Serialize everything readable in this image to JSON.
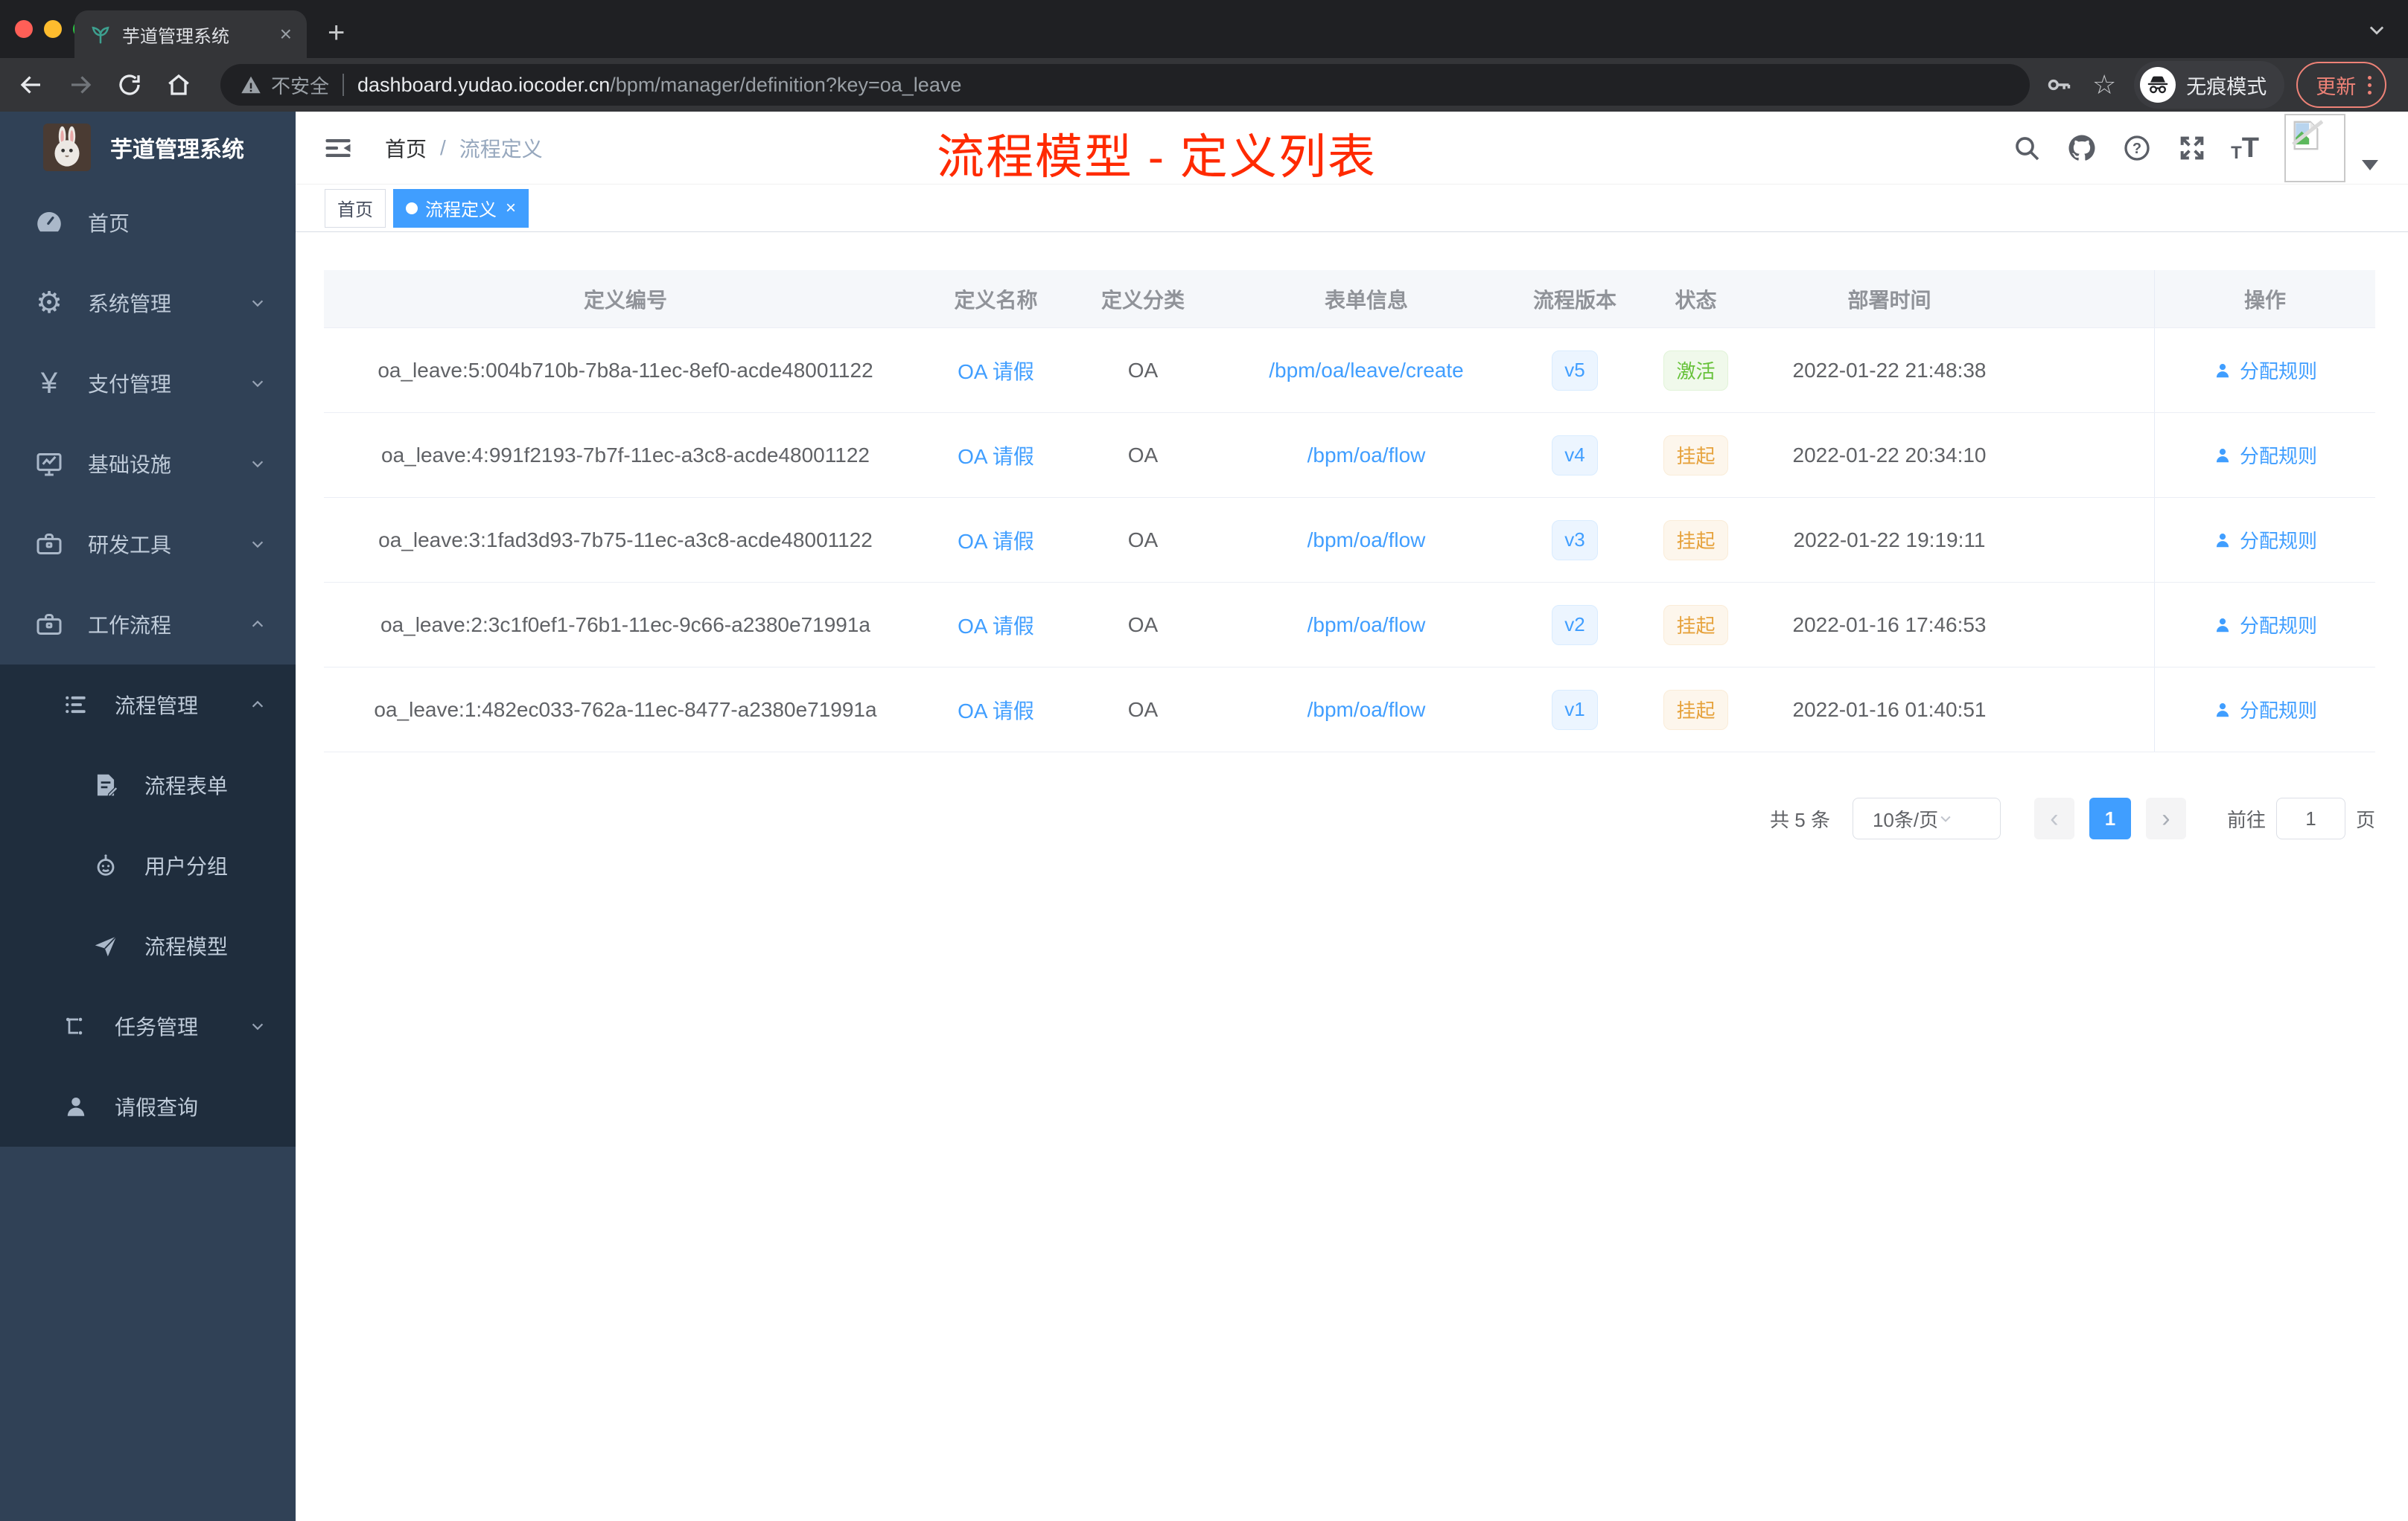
{
  "browser": {
    "tab_title": "芋道管理系统",
    "not_secure_label": "不安全",
    "url_host": "dashboard.yudao.iocoder.cn",
    "url_path": "/bpm/manager/definition?key=oa_leave",
    "incognito_label": "无痕模式",
    "update_label": "更新"
  },
  "icons": {
    "close_glyph": "×",
    "new_tab_glyph": "+",
    "star_glyph": "☆",
    "gear_glyph": "⚙",
    "yen_glyph": "¥",
    "question_glyph": "?",
    "font_small": "T",
    "font_large": "T",
    "prev_glyph": "‹",
    "next_glyph": "›",
    "breadcrumb_sep": "/"
  },
  "annotation": {
    "text": "流程模型 - 定义列表",
    "color": "#ff2a00"
  },
  "sidebar": {
    "app_title": "芋道管理系统",
    "items": [
      {
        "label": "首页",
        "icon": "dashboard-icon"
      },
      {
        "label": "系统管理",
        "icon": "gear-icon",
        "chevron": "down"
      },
      {
        "label": "支付管理",
        "icon": "yen-icon",
        "chevron": "down"
      },
      {
        "label": "基础设施",
        "icon": "monitor-icon",
        "chevron": "down"
      },
      {
        "label": "研发工具",
        "icon": "toolbox-icon",
        "chevron": "down"
      },
      {
        "label": "工作流程",
        "icon": "briefcase-icon",
        "chevron": "up"
      }
    ],
    "submenu": [
      {
        "label": "流程管理",
        "icon": "list-icon",
        "chevron": "up"
      },
      {
        "label": "流程表单",
        "icon": "form-icon"
      },
      {
        "label": "用户分组",
        "icon": "robot-icon"
      },
      {
        "label": "流程模型",
        "icon": "paper-plane-icon"
      },
      {
        "label": "任务管理",
        "icon": "tree-icon",
        "chevron": "down"
      },
      {
        "label": "请假查询",
        "icon": "user-icon"
      }
    ]
  },
  "navbar": {
    "breadcrumb_home": "首页",
    "breadcrumb_current": "流程定义"
  },
  "tags": {
    "home": "首页",
    "active": "流程定义"
  },
  "table": {
    "headers": [
      "定义编号",
      "定义名称",
      "定义分类",
      "表单信息",
      "流程版本",
      "状态",
      "部署时间",
      "操作"
    ],
    "action_label": "分配规则",
    "rows": [
      {
        "id": "oa_leave:5:004b710b-7b8a-11ec-8ef0-acde48001122",
        "name": "OA 请假",
        "category": "OA",
        "form": "/bpm/oa/leave/create",
        "version": "v5",
        "status": "激活",
        "deploy_time": "2022-01-22 21:48:38"
      },
      {
        "id": "oa_leave:4:991f2193-7b7f-11ec-a3c8-acde48001122",
        "name": "OA 请假",
        "category": "OA",
        "form": "/bpm/oa/flow",
        "version": "v4",
        "status": "挂起",
        "deploy_time": "2022-01-22 20:34:10"
      },
      {
        "id": "oa_leave:3:1fad3d93-7b75-11ec-a3c8-acde48001122",
        "name": "OA 请假",
        "category": "OA",
        "form": "/bpm/oa/flow",
        "version": "v3",
        "status": "挂起",
        "deploy_time": "2022-01-22 19:19:11"
      },
      {
        "id": "oa_leave:2:3c1f0ef1-76b1-11ec-9c66-a2380e71991a",
        "name": "OA 请假",
        "category": "OA",
        "form": "/bpm/oa/flow",
        "version": "v2",
        "status": "挂起",
        "deploy_time": "2022-01-16 17:46:53"
      },
      {
        "id": "oa_leave:1:482ec033-762a-11ec-8477-a2380e71991a",
        "name": "OA 请假",
        "category": "OA",
        "form": "/bpm/oa/flow",
        "version": "v1",
        "status": "挂起",
        "deploy_time": "2022-01-16 01:40:51"
      }
    ]
  },
  "pagination": {
    "total": "共 5 条",
    "page_size": "10条/页",
    "page": "1",
    "goto_label": "前往",
    "goto_value": "1",
    "goto_unit": "页"
  },
  "colors": {
    "accent": "#409eff",
    "active_tag_bg": "#409eff",
    "status_active_text": "#67c23a",
    "status_suspended_text": "#e6a23c",
    "version_text": "#409eff",
    "annotation_red": "#ff2a00",
    "sidebar_bg": "#304156",
    "submenu_bg": "#1f2d3d",
    "table_header_bg": "#f5f7fa"
  }
}
